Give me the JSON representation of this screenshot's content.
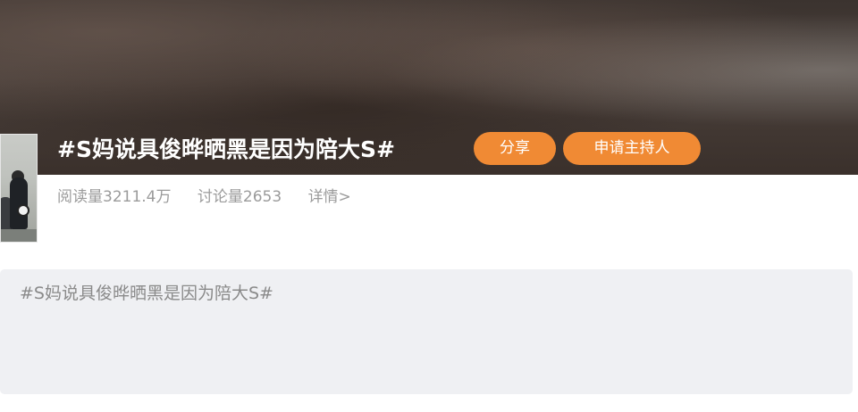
{
  "topic": {
    "title": "#S妈说具俊晔晒黑是因为陪大S#",
    "share_label": "分享",
    "apply_host_label": "申请主持人",
    "read_count": "阅读量3211.4万",
    "discussion_count": "讨论量2653",
    "details_label": "详情>"
  },
  "composer": {
    "placeholder_text": "#S妈说具俊晔晒黑是因为陪大S#"
  },
  "colors": {
    "accent_orange": "#f08a34",
    "muted_text": "#9b9b9b",
    "composer_bg": "#eff0f3"
  }
}
